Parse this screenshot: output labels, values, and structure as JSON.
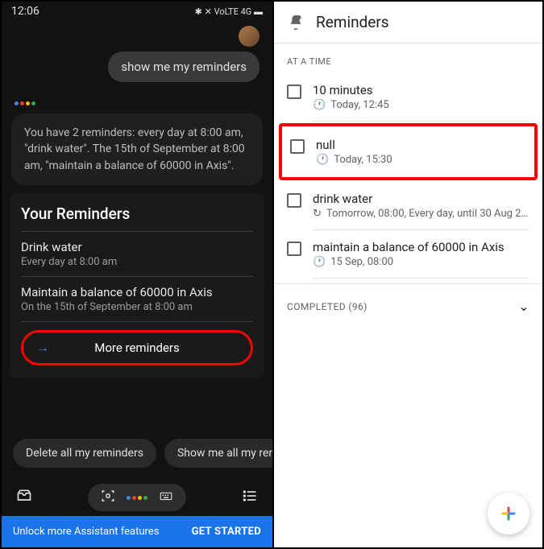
{
  "left": {
    "status": {
      "time": "12:06",
      "icons": "✱ ✕ VoLTE 4G ▬"
    },
    "user_message": "show me my reminders",
    "assistant_text": "You have 2 reminders: every day at 8:00 am, \"drink water\". The 15th of September at 8:00 am, \"maintain a balance of 60000 in Axis\".",
    "card": {
      "title": "Your Reminders",
      "items": [
        {
          "title": "Drink water",
          "sub": "Every day at 8:00 am"
        },
        {
          "title": "Maintain a balance of 60000 in Axis",
          "sub": "On the 15th of September at 8:00 am"
        }
      ],
      "more_btn": "More reminders"
    },
    "chips": [
      "Delete all my reminders",
      "Show me all my rem"
    ],
    "banner": {
      "text": "Unlock more Assistant features",
      "cta": "GET STARTED"
    }
  },
  "right": {
    "header": "Reminders",
    "section": "AT A TIME",
    "items": [
      {
        "title": "10 minutes",
        "sub": "Today, 12:45",
        "icon": "clock",
        "hl": false
      },
      {
        "title": "null",
        "sub": "Today, 15:30",
        "icon": "clock",
        "hl": true
      },
      {
        "title": "drink water",
        "sub": "Tomorrow, 08:00, Every day, until 30 Aug 2…",
        "icon": "repeat",
        "hl": false
      },
      {
        "title": "maintain a balance of 60000 in Axis",
        "sub": "15 Sep, 08:00",
        "icon": "clock",
        "hl": false
      }
    ],
    "completed": "COMPLETED (96)"
  }
}
